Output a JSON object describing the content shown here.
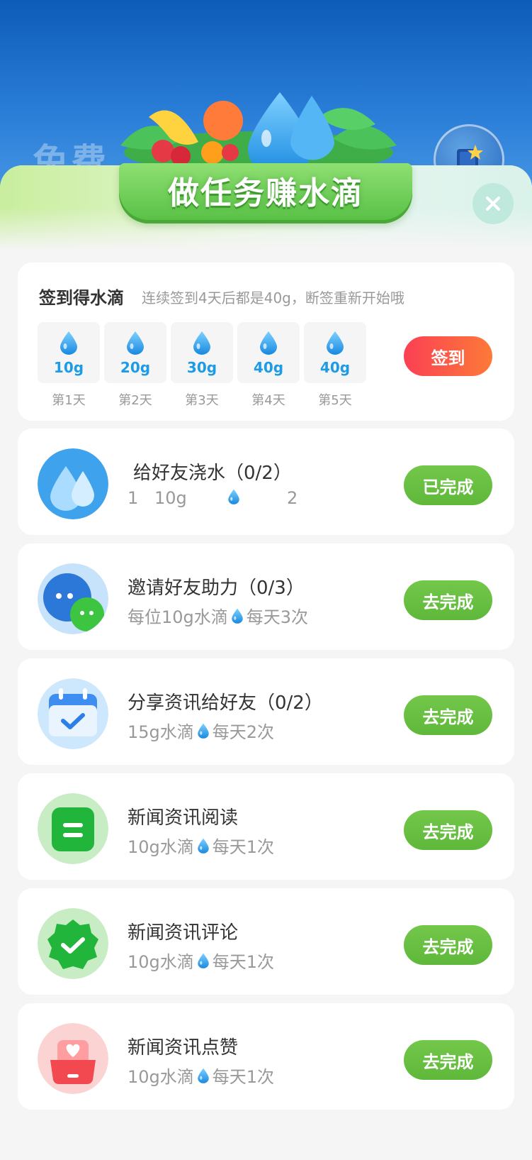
{
  "header": {
    "ghost_text": "免费",
    "title": "做任务赚水滴"
  },
  "checkin": {
    "title": "签到得水滴",
    "subtitle": "连续签到4天后都是40g，断签重新开始哦",
    "button_label": "签到",
    "days": [
      {
        "amount": "10g",
        "label": "第1天"
      },
      {
        "amount": "20g",
        "label": "第2天"
      },
      {
        "amount": "30g",
        "label": "第3天"
      },
      {
        "amount": "40g",
        "label": "第4天"
      },
      {
        "amount": "40g",
        "label": "第5天"
      }
    ]
  },
  "tasks": [
    {
      "title": "给好友浇水（0/2）",
      "sub_parts": [
        "1",
        "10g",
        "2"
      ],
      "button": "已完成",
      "icon": "water-drops-icon"
    },
    {
      "title": "邀请好友助力（0/3）",
      "sub_before": "每位10g水滴",
      "sub_after": "每天3次",
      "button": "去完成",
      "icon": "wechat-invite-icon"
    },
    {
      "title": "分享资讯给好友（0/2）",
      "sub_before": "15g水滴",
      "sub_after": "每天2次",
      "button": "去完成",
      "icon": "calendar-check-icon"
    },
    {
      "title": "新闻资讯阅读",
      "sub_before": "10g水滴",
      "sub_after": "每天1次",
      "button": "去完成",
      "icon": "news-read-icon"
    },
    {
      "title": "新闻资讯评论",
      "sub_before": "10g水滴",
      "sub_after": "每天1次",
      "button": "去完成",
      "icon": "badge-check-icon"
    },
    {
      "title": "新闻资讯点赞",
      "sub_before": "10g水滴",
      "sub_after": "每天1次",
      "button": "去完成",
      "icon": "heart-like-icon"
    }
  ],
  "colors": {
    "accent_green": "#5fb83b",
    "checkin_red": "#fb4054",
    "drop_blue": "#1e9be6"
  }
}
